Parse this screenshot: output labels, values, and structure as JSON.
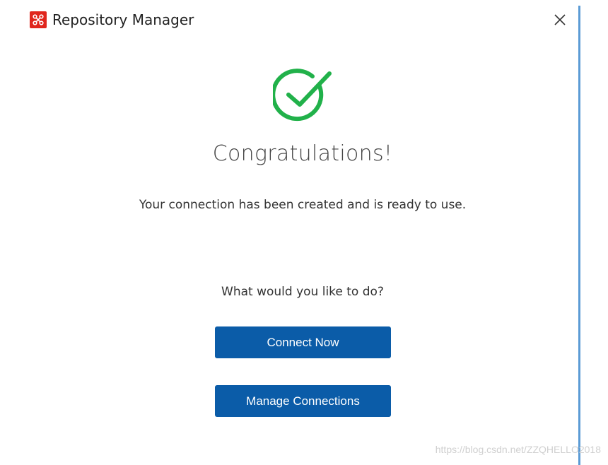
{
  "window": {
    "title": "Repository Manager",
    "logo_icon": "app-logo-icon",
    "close_icon": "close-icon"
  },
  "content": {
    "success_icon": "check-circle-icon",
    "heading": "Congratulations!",
    "message": "Your connection has been created and is ready to use.",
    "question": "What would you like to do?"
  },
  "actions": {
    "connect_now_label": "Connect Now",
    "manage_connections_label": "Manage Connections"
  },
  "watermark": "https://blog.csdn.net/ZZQHELLO2018",
  "colors": {
    "primary_button": "#0b5ca8",
    "success_green": "#21b14a",
    "logo_red": "#e0261d",
    "window_edge": "#5b9bd5"
  }
}
